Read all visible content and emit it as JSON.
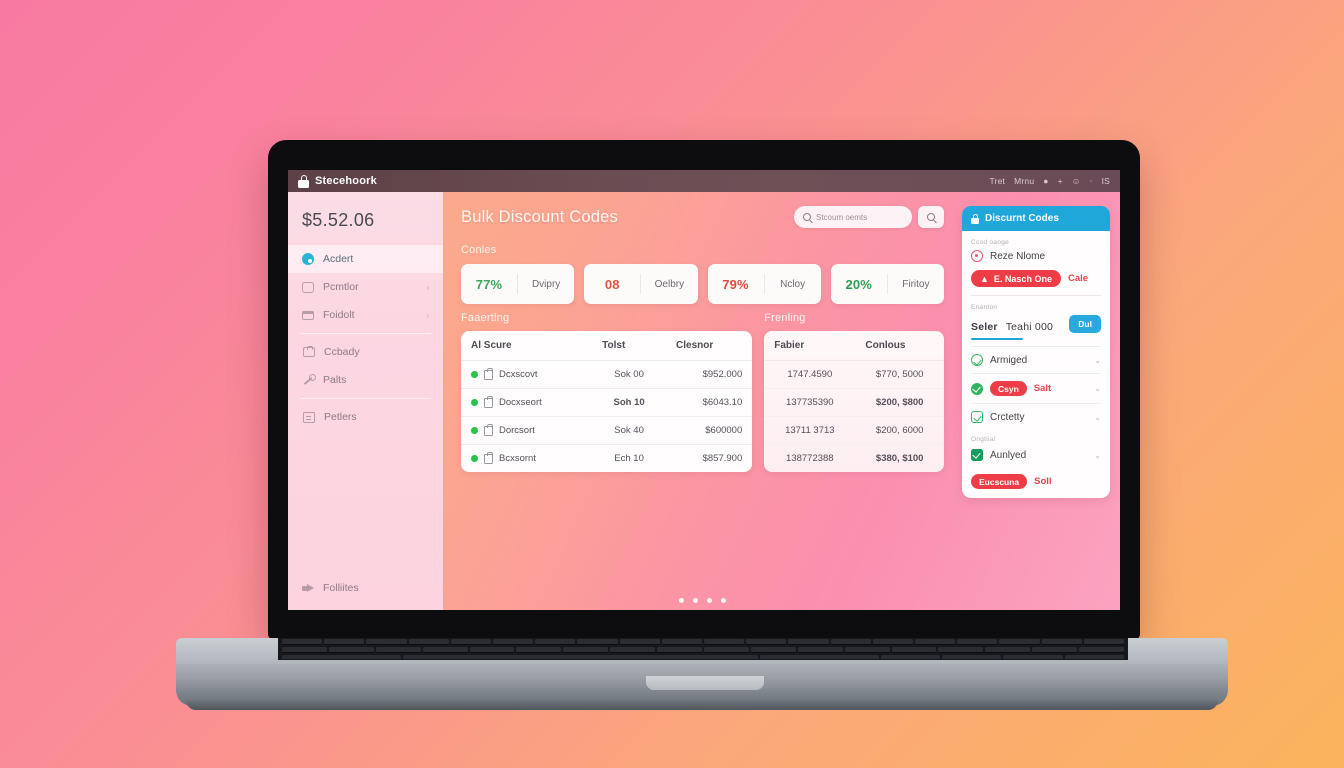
{
  "menubar": {
    "app_name": "Stecehoork",
    "brand_icon": "lock-icon",
    "items": [
      "Tret",
      "Mrnu"
    ],
    "icons": [
      "apple-icon",
      "plus-icon",
      "face-icon",
      "battery-icon",
      "clock-icon"
    ],
    "apple_glyph": "●",
    "plus_glyph": "+",
    "face_glyph": "☺",
    "clock_glyph": "IS"
  },
  "sidebar": {
    "balance": "$5.52.06",
    "items": [
      {
        "label": "Acdert",
        "icon": "target-icon",
        "active": true,
        "chevron": ""
      },
      {
        "label": "Pcmtlor",
        "icon": "people-icon",
        "active": false,
        "chevron": "›"
      },
      {
        "label": "Foidolt",
        "icon": "window-icon",
        "active": false,
        "chevron": "›"
      },
      {
        "label": "Ccbady",
        "icon": "bag-icon",
        "active": false,
        "chevron": ""
      },
      {
        "label": "Palts",
        "icon": "wrench-icon",
        "active": false,
        "chevron": ""
      },
      {
        "label": "Petlers",
        "icon": "document-icon",
        "active": false,
        "chevron": ""
      }
    ],
    "bottom_item": {
      "label": "Folliites",
      "icon": "megaphone-icon"
    }
  },
  "main": {
    "page_title": "Bulk Discount Codes",
    "search": {
      "placeholder": "Stcoum oemts",
      "icon": "search-icon",
      "button_icon": "search-icon"
    },
    "codes_section_label": "Conles",
    "codes": [
      {
        "percent": "77%",
        "name": "Dvipry",
        "color": "#3aa85a"
      },
      {
        "percent": "08",
        "name": "Oelbry",
        "color": "#e0543f"
      },
      {
        "percent": "79%",
        "name": "Ncloy",
        "color": "#e04a3f"
      },
      {
        "percent": "20%",
        "name": "Firitoy",
        "color": "#2f9e52"
      }
    ],
    "left_table": {
      "title": "Faaertlng",
      "columns": [
        "Al Scure",
        "Tolst",
        "Clesnor"
      ],
      "rows": [
        {
          "name": "Dcxscovt",
          "total": "Sok 00",
          "total_negative": false,
          "amount": "$952.000"
        },
        {
          "name": "Docxseort",
          "total": "Soh 10",
          "total_negative": true,
          "amount": "$6043.10"
        },
        {
          "name": "Dorcsort",
          "total": "Sok 40",
          "total_negative": false,
          "amount": "$600000"
        },
        {
          "name": "Bcxsornt",
          "total": "Ech 10",
          "total_negative": false,
          "amount": "$857.900"
        }
      ]
    },
    "right_table": {
      "title": "Frenling",
      "columns": [
        "Fabier",
        "Conlous"
      ],
      "rows": [
        {
          "fabier": "1747.4590",
          "contous": "$770, 5000",
          "negative": false
        },
        {
          "fabier": "137735390",
          "contous": "$200, $800",
          "negative": true
        },
        {
          "fabier": "13711 3713",
          "contous": "$200, 6000",
          "negative": false
        },
        {
          "fabier": "138772388",
          "contous": "$380, $100",
          "negative": true
        }
      ]
    },
    "pagination_dots": 4
  },
  "right_panel": {
    "header": {
      "title": "Discurnt Codes",
      "icon": "lock-icon"
    },
    "micro_label_top": "Ccod oaoge",
    "name_row": {
      "label": "Reze Nlome",
      "icon": "circle-dot-icon"
    },
    "badge_row": {
      "pill": "E. Nasch One",
      "pill_icon": "tag-icon",
      "side_text": "Cale"
    },
    "field": {
      "micro_label": "Enanton",
      "label": "Seler",
      "value": "Teahi 000",
      "button": "Dul"
    },
    "options": [
      {
        "label": "Armiged",
        "icon": "check-circle-outline-icon",
        "chevron": "⌄",
        "pill": "",
        "side": ""
      },
      {
        "label": "",
        "icon": "check-circle-filled-icon",
        "chevron": "⌄",
        "pill": "Csyn",
        "side": "Salt"
      },
      {
        "label": "Crctetty",
        "icon": "check-square-icon",
        "chevron": "⌄",
        "pill": "",
        "side": ""
      }
    ],
    "group_micro_label": "Ongtiial",
    "last_option": {
      "label": "Aunlyed",
      "icon": "check-filled-icon",
      "chevron": "⌄"
    },
    "footer": {
      "pill": "Eucscuna",
      "side": "Soll"
    }
  },
  "colors": {
    "accent_blue": "#1fa7da",
    "alert_red": "#ef3d47",
    "success_green": "#29c24a",
    "bg_gradient_start": "#f87aa2",
    "bg_gradient_end": "#fbb45c"
  }
}
